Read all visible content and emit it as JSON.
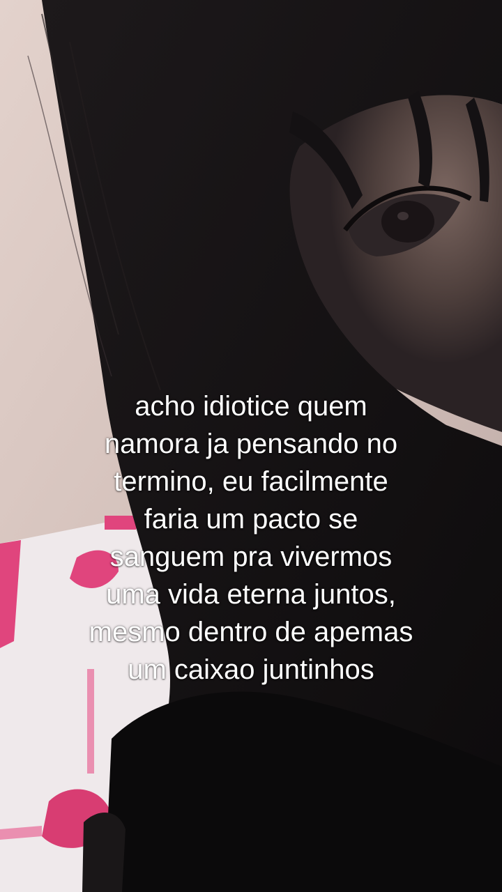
{
  "caption": {
    "lines": [
      "acho idiotice quem",
      "namora ja pensando no",
      "termino, eu facilmente",
      "faria um pacto se",
      "sanguem pra vivermos",
      "uma vida eterna juntos,",
      "mesmo dentro de apemas",
      "um caixao juntinhos"
    ]
  },
  "colors": {
    "wall": "#d9c9c4",
    "hair": "#141113",
    "skin": "#6e5a55",
    "pillow": "#f1ecee",
    "pink_pattern": "#e0457d",
    "caption_text": "#ffffff"
  },
  "icons": {
    "background": "photo"
  }
}
